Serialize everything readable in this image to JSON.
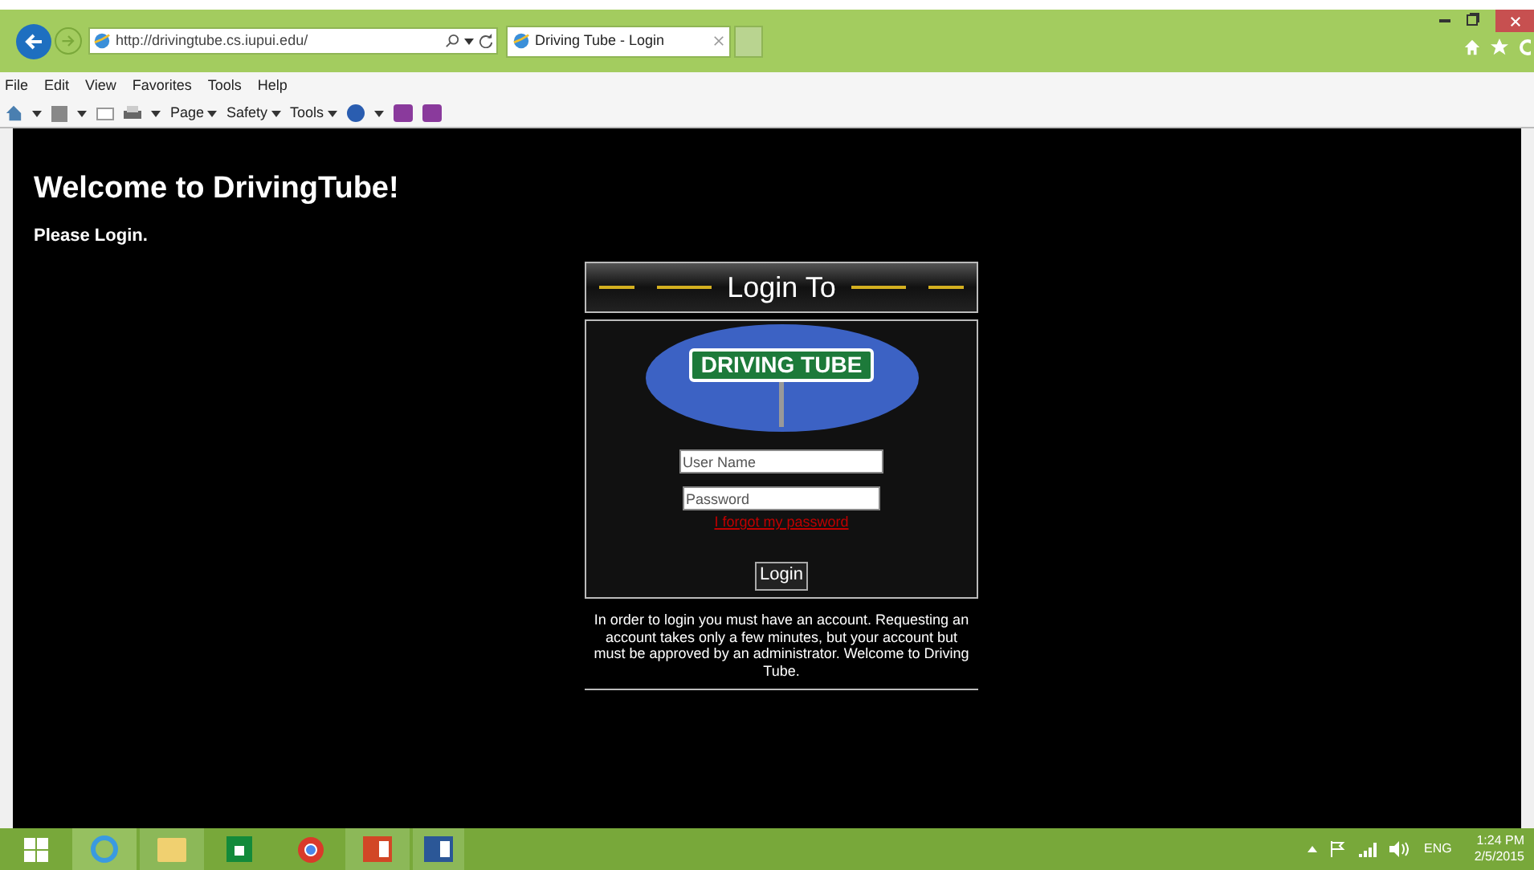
{
  "browser": {
    "url": "http://drivingtube.cs.iupui.edu/",
    "tab_title": "Driving Tube - Login",
    "menu": [
      "File",
      "Edit",
      "View",
      "Favorites",
      "Tools",
      "Help"
    ],
    "commands": [
      "Page",
      "Safety",
      "Tools"
    ]
  },
  "page": {
    "heading": "Welcome to DrivingTube!",
    "subheading": "Please Login.",
    "login_title": "Login To",
    "logo_text": "DRIVING TUBE",
    "username": {
      "placeholder": "User Name"
    },
    "password": {
      "placeholder": "Password"
    },
    "forgot_link": "I forgot my password",
    "login_button": "Login",
    "info": "In order to login you must have an account. Requesting an account takes only a few minutes, but your account but must be approved by an administrator. Welcome to Driving Tube."
  },
  "taskbar": {
    "language": "ENG",
    "time": "1:24 PM",
    "date": "2/5/2015"
  }
}
